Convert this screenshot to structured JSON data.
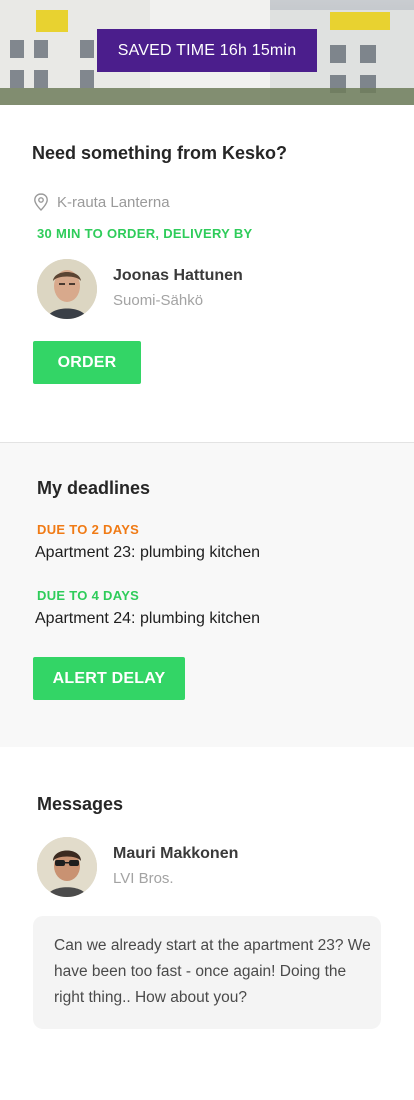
{
  "hero": {
    "saved_time_label": "SAVED TIME 16h 15min"
  },
  "order_section": {
    "title": "Need something from Kesko?",
    "location": "K-rauta Lanterna",
    "notice": "30 MIN TO ORDER, DELIVERY BY",
    "contact": {
      "name": "Joonas Hattunen",
      "company": "Suomi-Sähkö"
    },
    "order_button": "ORDER"
  },
  "deadlines_section": {
    "title": "My deadlines",
    "items": [
      {
        "due": "DUE TO 2 DAYS",
        "task": "Apartment 23: plumbing kitchen",
        "color": "#f07a14"
      },
      {
        "due": "DUE TO 4 DAYS",
        "task": "Apartment 24: plumbing kitchen",
        "color": "#2ecc5a"
      }
    ],
    "alert_button": "ALERT DELAY"
  },
  "messages_section": {
    "title": "Messages",
    "sender": {
      "name": "Mauri Makkonen",
      "company": "LVI Bros."
    },
    "message": "Can we already start at the apartment 23? We have been too fast - once again! Doing the right thing.. How about you?"
  },
  "colors": {
    "accent_green": "#33d566",
    "banner_purple": "#4b1e8c",
    "warning_orange": "#f07a14"
  },
  "icons": {
    "location": "map-pin-icon"
  }
}
